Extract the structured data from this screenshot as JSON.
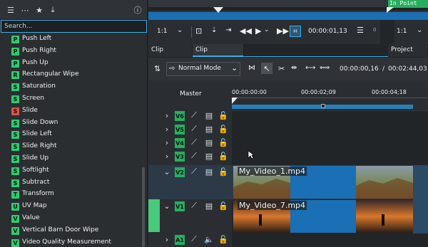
{
  "effects": {
    "search_placeholder": "Search...",
    "items": [
      {
        "badge": "P",
        "name": "Push Left",
        "color": "#2ecc71"
      },
      {
        "badge": "P",
        "name": "Push Right",
        "color": "#2ecc71"
      },
      {
        "badge": "P",
        "name": "Push Up",
        "color": "#2ecc71"
      },
      {
        "badge": "R",
        "name": "Rectangular Wipe",
        "color": "#2ecc71"
      },
      {
        "badge": "S",
        "name": "Saturation",
        "color": "#2ecc71"
      },
      {
        "badge": "S",
        "name": "Screen",
        "color": "#2ecc71"
      },
      {
        "badge": "S",
        "name": "Slide",
        "color": "#d9534f"
      },
      {
        "badge": "S",
        "name": "Slide Down",
        "color": "#2ecc71"
      },
      {
        "badge": "S",
        "name": "Slide Left",
        "color": "#2ecc71"
      },
      {
        "badge": "S",
        "name": "Slide Right",
        "color": "#2ecc71"
      },
      {
        "badge": "S",
        "name": "Slide Up",
        "color": "#2ecc71"
      },
      {
        "badge": "S",
        "name": "Softlight",
        "color": "#2ecc71"
      },
      {
        "badge": "S",
        "name": "Subtract",
        "color": "#2ecc71"
      },
      {
        "badge": "T",
        "name": "Transform",
        "color": "#2ecc71"
      },
      {
        "badge": "U",
        "name": "UV Map",
        "color": "#2ecc71"
      },
      {
        "badge": "V",
        "name": "Value",
        "color": "#2ecc71"
      },
      {
        "badge": "V",
        "name": "Vertical Barn Door Wipe",
        "color": "#2ecc71"
      },
      {
        "badge": "V",
        "name": "Video Quality Measurement",
        "color": "#2ecc71"
      }
    ]
  },
  "monitor": {
    "in_point": "In Point",
    "zoom_left": "1:1",
    "zoom_right": "1:1",
    "timecode": "00:00:01,13",
    "mark": "0"
  },
  "tabs": [
    "Clip Monitor",
    "Clip Properties",
    "Project Monit"
  ],
  "timeline": {
    "mode": "Normal Mode",
    "position": "00:00:00,16",
    "duration": "00:02:44,03",
    "master": "Master",
    "ruler": [
      "00:00:00:00",
      "00:00:02;09",
      "00:00:04;18"
    ],
    "tracks": [
      {
        "name": "V6"
      },
      {
        "name": "V5"
      },
      {
        "name": "V4"
      },
      {
        "name": "V3"
      },
      {
        "name": "V2"
      },
      {
        "name": "V1"
      },
      {
        "name": "A1"
      }
    ],
    "clips": [
      {
        "label": "My_Video_1.mp4"
      },
      {
        "label": "My_Video_7.mp4"
      }
    ]
  },
  "colors": {
    "accent": "#3daee9",
    "track_badge": "#27ae60",
    "clip_blue": "#1a6fb5"
  }
}
